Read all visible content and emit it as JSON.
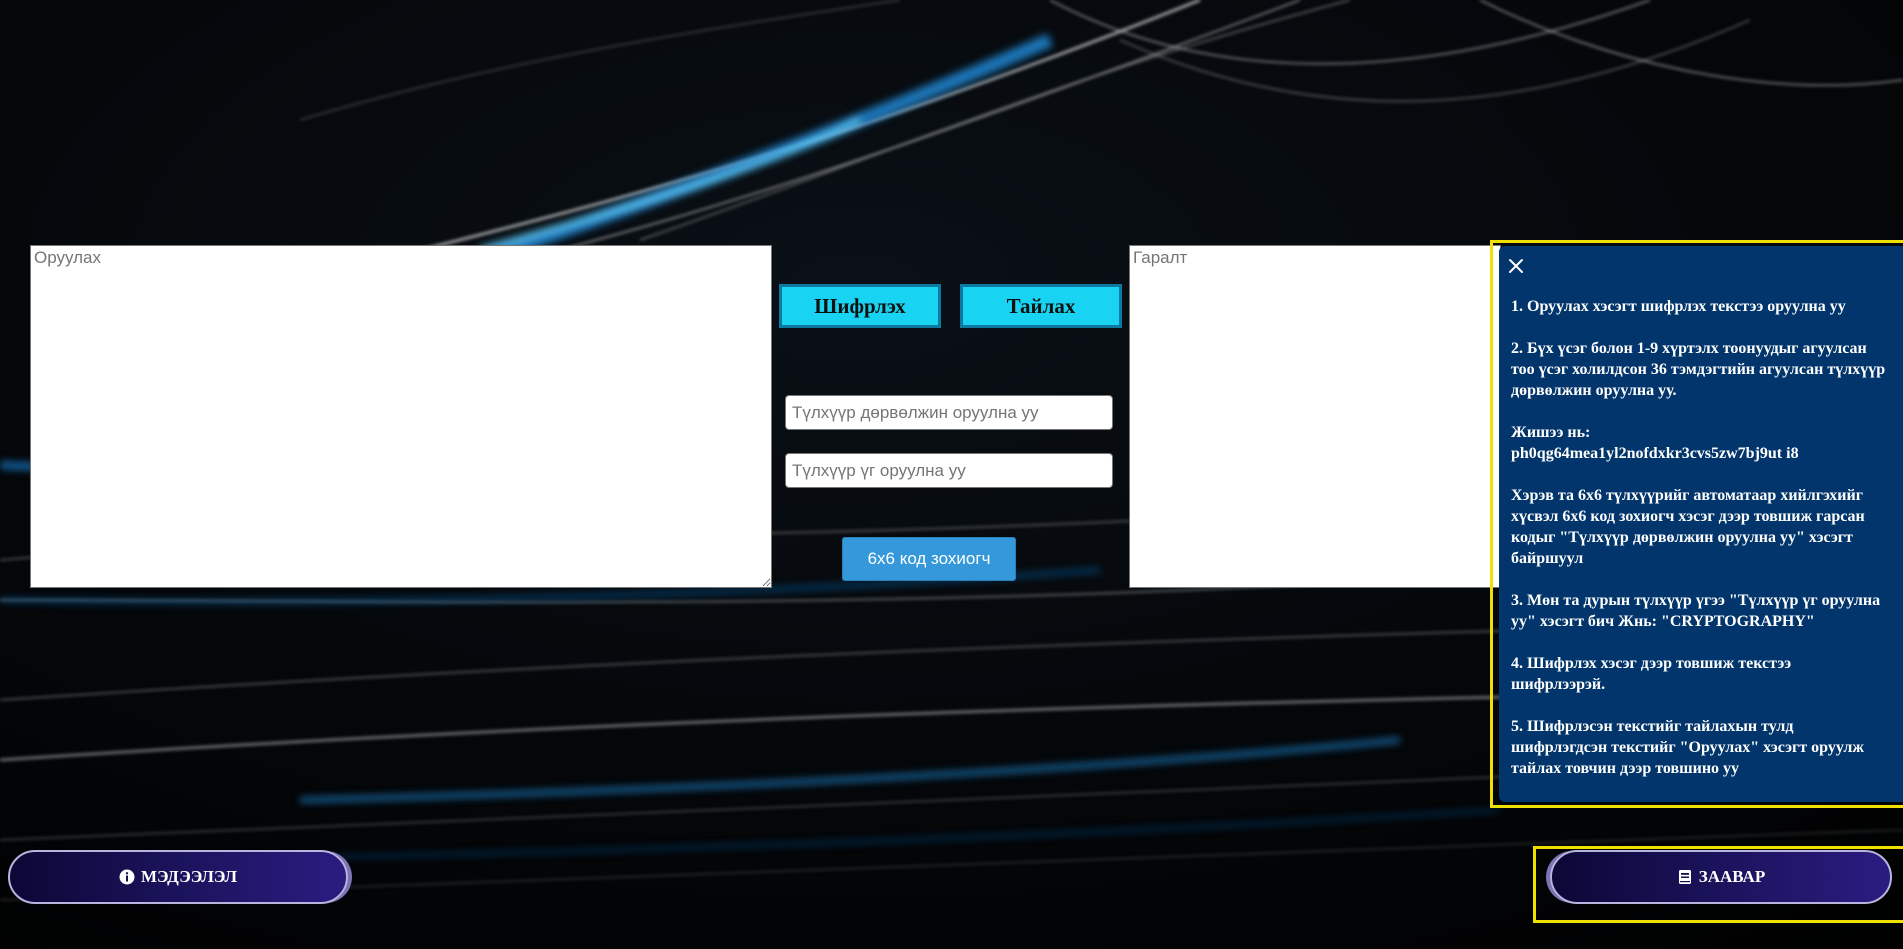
{
  "encryptor": {
    "input_placeholder": "Оруулах",
    "output_placeholder": "Гаралт",
    "encrypt_label": "Шифрлэх",
    "decrypt_label": "Тайлах",
    "key_square_placeholder": "Түлхүүр дөрвөлжин оруулна уу",
    "keyword_placeholder": "Түлхүүр үг оруулна уу",
    "generator_label": "6x6 код зохиогч"
  },
  "instructions": {
    "close_icon": "close-icon",
    "step1": "1. Оруулах хэсэгт шифрлэх текстээ оруулна уу",
    "step2": "2. Бүх үсэг болон 1-9 хүртэлх тоонуудыг агуулсан тоо үсэг холилдсон 36 тэмдэгтийн агуулсан түлхүүр дөрвөлжин оруулна уу.",
    "example_label": "Жишээ нь:",
    "example_value": "ph0qg64mea1yl2nofdxkr3cvs5zw7bj9ut i8",
    "auto_note": "Хэрэв та 6x6 түлхүүрийг автоматаар хийлгэхийг хүсвэл 6x6 код зохиогч хэсэг дээр товшиж гарсан кодыг \"Түлхүүр дөрвөлжин оруулна уу\" хэсэгт байршуул",
    "step3": "3. Мөн та дурын түлхүүр үгээ \"Түлхүүр үг оруулна уу\" хэсэгт бич Жнь: \"CRYPTOGRAPHY\"",
    "step4": "4. Шифрлэх хэсэг дээр товшиж текстээ шифрлээрэй.",
    "step5": "5. Шифрлэсэн текстийг тайлахын тулд шифрлэгдсэн текстийг \"Оруулах\" хэсэгт оруулж тайлах товчин дээр товшино уу"
  },
  "footer": {
    "info_label": "МЭДЭЭЛЭЛ",
    "info_icon": "info-circle-icon",
    "guide_label": "ЗААВАР",
    "guide_icon": "book-icon"
  },
  "colors": {
    "cipher_button": "#18d4f2",
    "generator_button": "#3498db",
    "instruction_panel": "#01356b",
    "highlight_frame": "#f0e000",
    "pill_button": "#1c1460"
  }
}
